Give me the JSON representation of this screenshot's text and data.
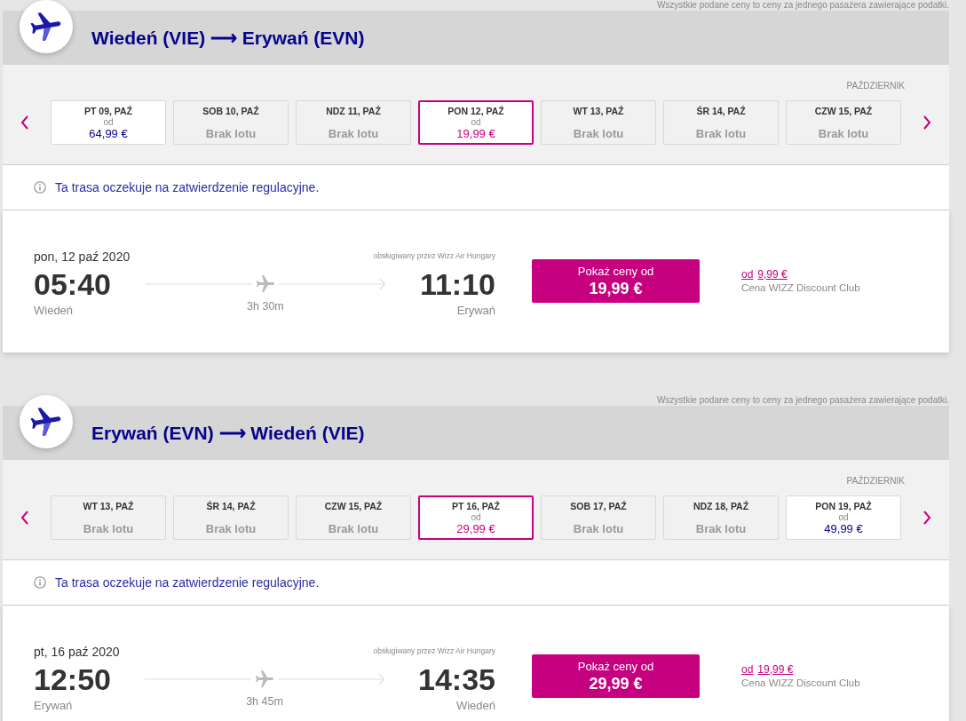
{
  "sections": [
    {
      "note": "Wszystkie podane ceny to ceny za jednego pasażera zawierające podatki.",
      "route": "Wiedeń (VIE) ⟶ Erywań (EVN)",
      "month": "PAŹDZIERNIK",
      "dates": [
        {
          "label": "PT 09, PAŹ",
          "kind": "price",
          "from_label": "od",
          "price": "64,99 €",
          "selected": false
        },
        {
          "label": "SOB 10, PAŹ",
          "kind": "no_flight",
          "status": "Brak lotu",
          "selected": false
        },
        {
          "label": "NDZ 11, PAŹ",
          "kind": "no_flight",
          "status": "Brak lotu",
          "selected": false
        },
        {
          "label": "PON 12, PAŹ",
          "kind": "price",
          "from_label": "od",
          "price": "19,99 €",
          "selected": true
        },
        {
          "label": "WT 13, PAŹ",
          "kind": "no_flight",
          "status": "Brak lotu",
          "selected": false
        },
        {
          "label": "ŚR 14, PAŹ",
          "kind": "no_flight",
          "status": "Brak lotu",
          "selected": false
        },
        {
          "label": "CZW 15, PAŹ",
          "kind": "no_flight",
          "status": "Brak lotu",
          "selected": false
        }
      ],
      "info": "Ta trasa oczekuje na zatwierdzenie regulacyjne.",
      "flight": {
        "date": "pon, 12 paź 2020",
        "operator": "obsługiwany przez Wizz Air Hungary",
        "departure_time": "05:40",
        "departure_city": "Wiedeń",
        "duration": "3h 30m",
        "arrival_time": "11:10",
        "arrival_city": "Erywań",
        "button_label": "Pokaż ceny od",
        "button_price": "19,99 €",
        "club_from": "od",
        "club_price": "9,99 €",
        "club_label": "Cena WIZZ Discount Club"
      }
    },
    {
      "note": "Wszystkie podane ceny to ceny za jednego pasażera zawierające podatki.",
      "route": "Erywań (EVN) ⟶ Wiedeń (VIE)",
      "month": "PAŹDZIERNIK",
      "dates": [
        {
          "label": "WT 13, PAŹ",
          "kind": "no_flight",
          "status": "Brak lotu",
          "selected": false
        },
        {
          "label": "ŚR 14, PAŹ",
          "kind": "no_flight",
          "status": "Brak lotu",
          "selected": false
        },
        {
          "label": "CZW 15, PAŹ",
          "kind": "no_flight",
          "status": "Brak lotu",
          "selected": false
        },
        {
          "label": "PT 16, PAŹ",
          "kind": "price",
          "from_label": "od",
          "price": "29,99 €",
          "selected": true
        },
        {
          "label": "SOB 17, PAŹ",
          "kind": "no_flight",
          "status": "Brak lotu",
          "selected": false
        },
        {
          "label": "NDZ 18, PAŹ",
          "kind": "no_flight",
          "status": "Brak lotu",
          "selected": false
        },
        {
          "label": "PON 19, PAŹ",
          "kind": "price",
          "from_label": "od",
          "price": "49,99 €",
          "selected": false
        }
      ],
      "info": "Ta trasa oczekuje na zatwierdzenie regulacyjne.",
      "flight": {
        "date": "pt, 16 paź 2020",
        "operator": "obsługiwany przez Wizz Air Hungary",
        "departure_time": "12:50",
        "departure_city": "Erywań",
        "duration": "3h 45m",
        "arrival_time": "14:35",
        "arrival_city": "Wiedeń",
        "button_label": "Pokaż ceny od",
        "button_price": "29,99 €",
        "club_from": "od",
        "club_price": "19,99 €",
        "club_label": "Cena WIZZ Discount Club"
      }
    }
  ]
}
